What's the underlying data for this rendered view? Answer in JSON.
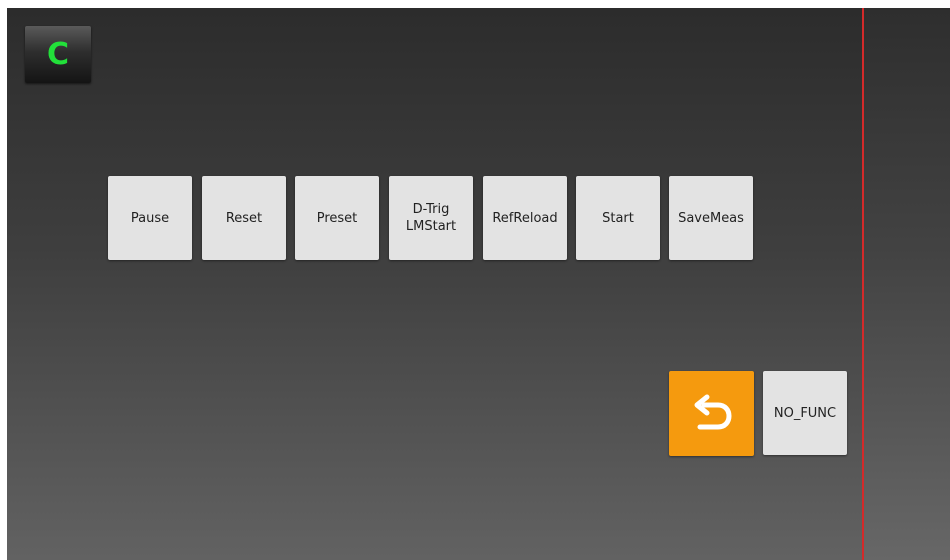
{
  "mode_badge": {
    "letter": "C",
    "color": "#22e03a"
  },
  "function_buttons": [
    {
      "label": "Pause"
    },
    {
      "label": "Reset"
    },
    {
      "label": "Preset"
    },
    {
      "label": "D-Trig\nLMStart"
    },
    {
      "label": "RefReload"
    },
    {
      "label": "Start"
    },
    {
      "label": "SaveMeas"
    }
  ],
  "back_button": {
    "icon": "return-arrow-icon",
    "color": "#f59a0e"
  },
  "no_func_button": {
    "label": "NO_FUNC"
  },
  "colors": {
    "divider": "#d42a2a",
    "button_bg": "#e3e3e3"
  }
}
